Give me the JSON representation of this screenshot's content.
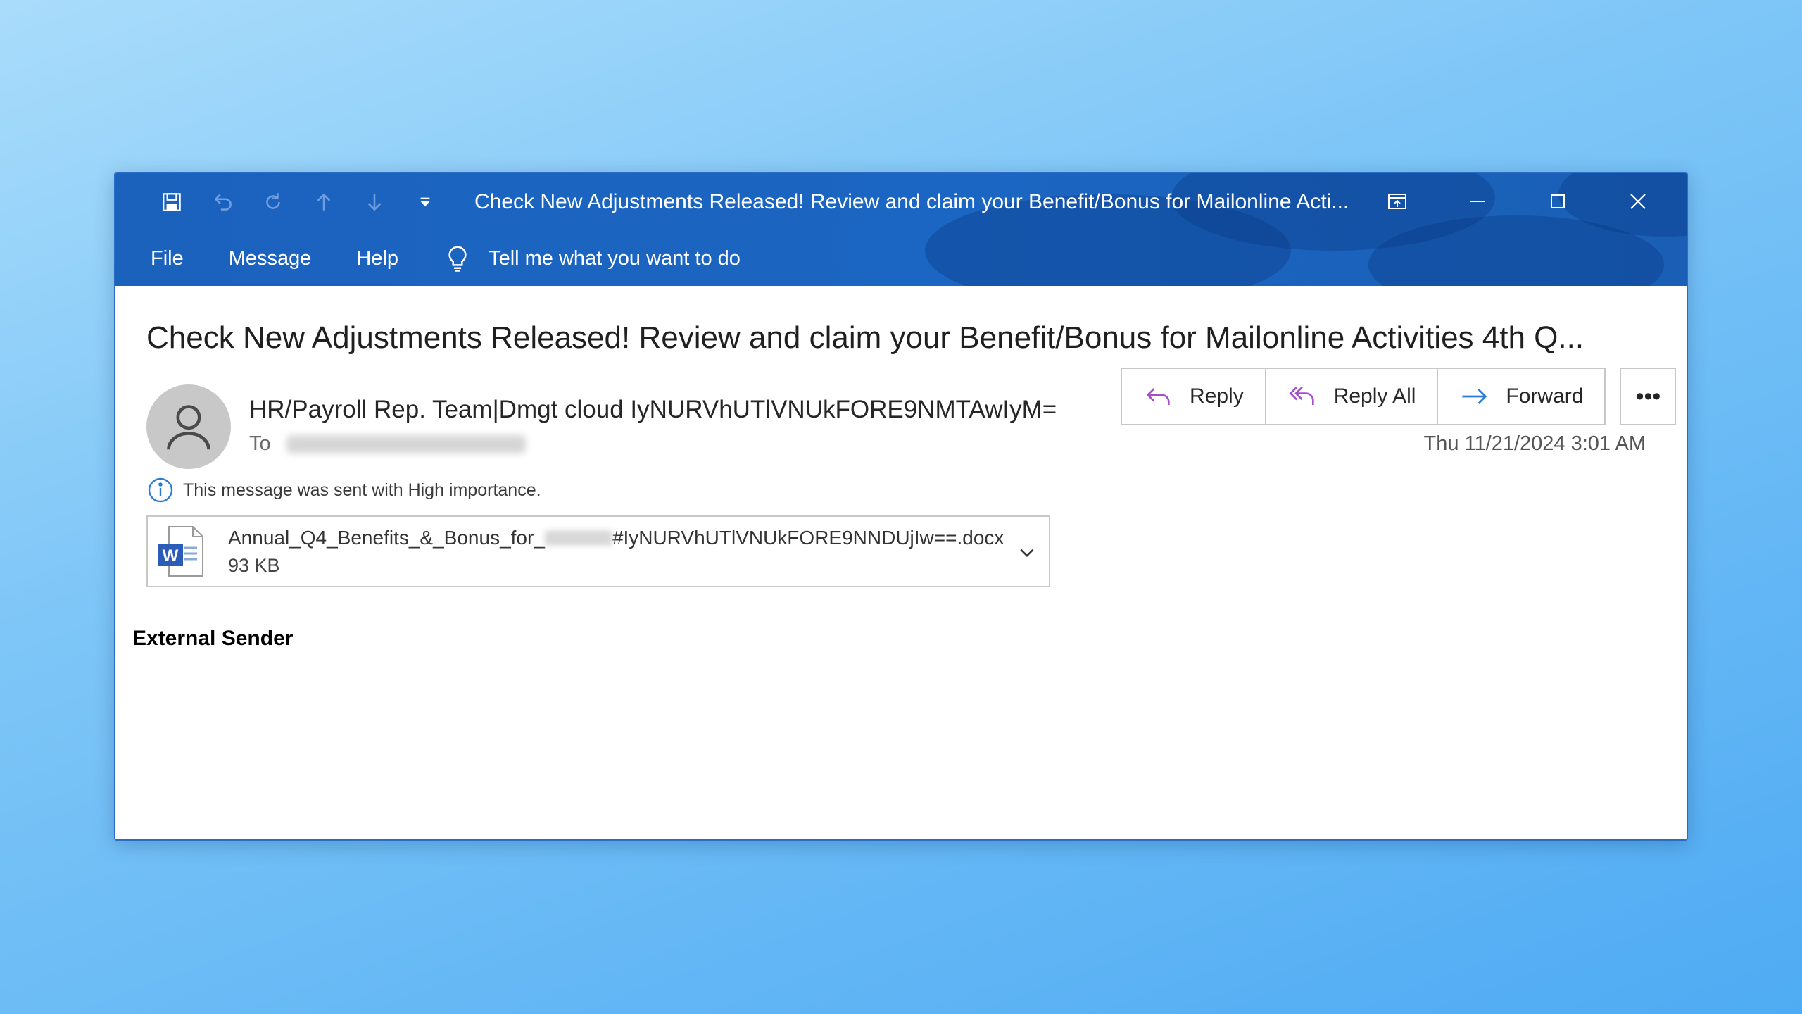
{
  "window": {
    "title": "Check New Adjustments Released! Review and claim your Benefit/Bonus for Mailonline Acti..."
  },
  "menu": {
    "file": "File",
    "message": "Message",
    "help": "Help",
    "tell_me": "Tell me what you want to do"
  },
  "email": {
    "subject": "Check New Adjustments Released! Review and claim your Benefit/Bonus for Mailonline Activities 4th Q...",
    "sender": "HR/Payroll Rep. Team|Dmgt cloud IyNURVhUTlVNUkFORE9NMTAwIyM=",
    "to_label": "To",
    "date": "Thu 11/21/2024 3:01 AM",
    "importance": "This message was sent with High importance.",
    "body_text": "External Sender"
  },
  "actions": {
    "reply": "Reply",
    "reply_all": "Reply All",
    "forward": "Forward",
    "more": "•••"
  },
  "attachment": {
    "name_prefix": "Annual_Q4_Benefits_&_Bonus_for_",
    "name_suffix": "#IyNURVhUTlVNUkFORE9NNDUjIw==.docx",
    "size": "93 KB",
    "word_badge": "W"
  },
  "colors": {
    "title_bar": "#1b62bd",
    "reply_arrow": "#a24fc9",
    "forward_arrow": "#2d7bd6",
    "info_icon": "#2b7cd3"
  }
}
